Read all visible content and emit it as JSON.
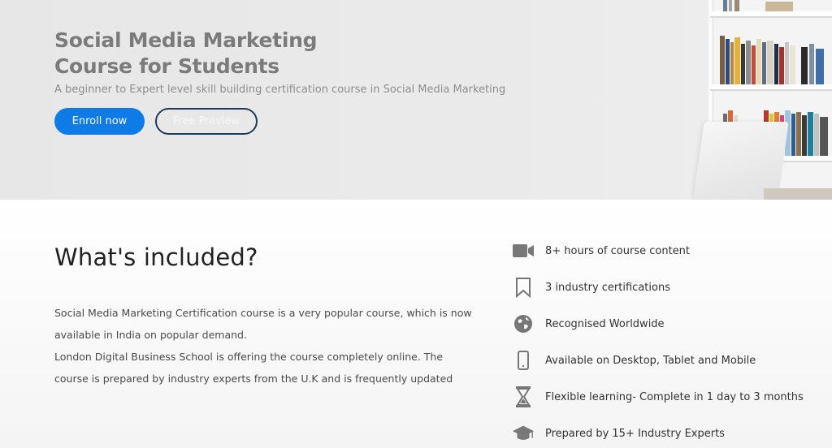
{
  "hero": {
    "title_line1": "Social Media Marketing",
    "title_line2": "Course for Students",
    "subtitle": "A beginner to Expert level skill building certification course in Social Media Marketing",
    "enroll_label": "Enroll now",
    "preview_label": "Free Preview"
  },
  "included": {
    "title": "What's included?",
    "paragraphs": [
      "Social Media Marketing Certification course is a very popular course, which is now available in India on popular demand.",
      "London Digital Business School is offering the course completely online. The course is prepared by industry experts from the U.K and is frequently updated"
    ]
  },
  "features": [
    {
      "icon": "video-camera-icon",
      "label": "8+ hours of course content"
    },
    {
      "icon": "bookmark-icon",
      "label": "3 industry certifications"
    },
    {
      "icon": "globe-icon",
      "label": "Recognised Worldwide"
    },
    {
      "icon": "mobile-phone-icon",
      "label": "Available on Desktop, Tablet and Mobile"
    },
    {
      "icon": "hourglass-icon",
      "label": "Flexible learning- Complete in 1 day to 3 months"
    },
    {
      "icon": "graduation-cap-icon",
      "label": "Prepared by 15+ Industry Experts"
    }
  ],
  "colors": {
    "primary_button": "#0f7be6",
    "outline_button_border": "#1e3b5a",
    "hero_background": "#e9e9e9",
    "icon_gray": "#777777"
  }
}
